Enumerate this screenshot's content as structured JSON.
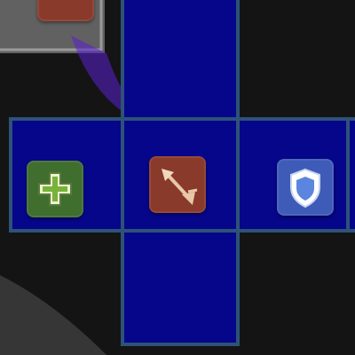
{
  "colors": {
    "background": "#141414",
    "tile_fill": "#06068a",
    "tile_border": "#2e5278",
    "highlight_room": "#6e6e6e",
    "path_glow": "#5a20d0"
  },
  "tiles": [
    {
      "id": "tile-top-center",
      "kind": "empty"
    },
    {
      "id": "tile-middle-left",
      "kind": "healing",
      "icon": "green-cross-icon",
      "badge_color": "#3f6e2f"
    },
    {
      "id": "tile-middle-center",
      "kind": "combat",
      "icon": "arrow-icon",
      "badge_color": "#8a3a2a"
    },
    {
      "id": "tile-middle-right",
      "kind": "defense",
      "icon": "shield-icon",
      "badge_color": "#3e5bb8"
    },
    {
      "id": "tile-bottom-center",
      "kind": "empty"
    },
    {
      "id": "tile-top-left-partial",
      "kind": "treasure",
      "icon": "loot-icon",
      "badge_color": "#8a3a2a"
    }
  ]
}
